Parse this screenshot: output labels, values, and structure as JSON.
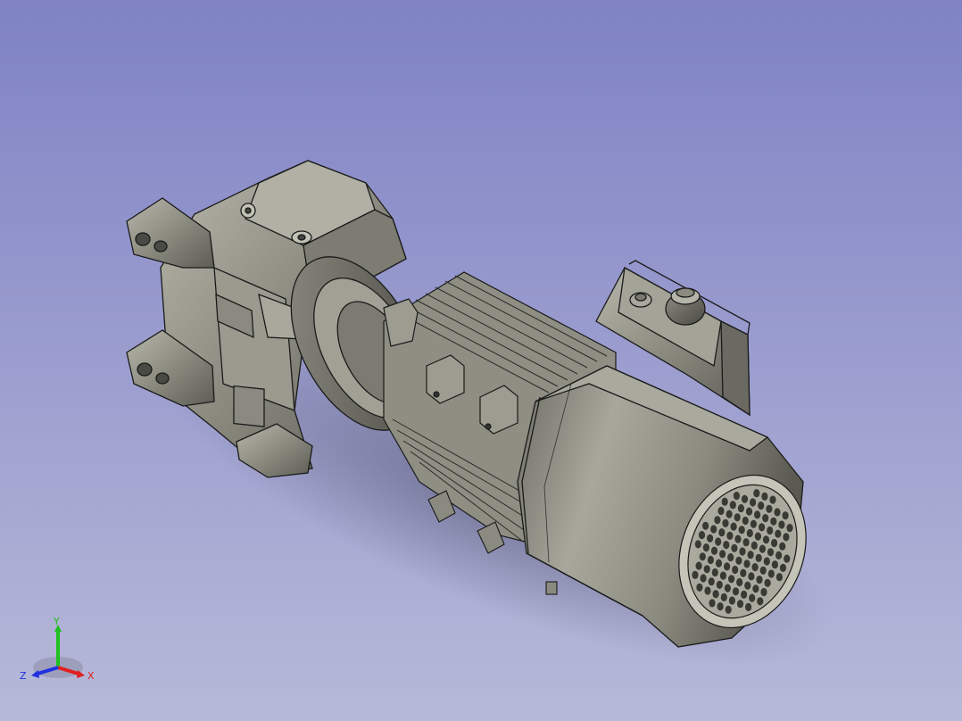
{
  "viewport": {
    "background_top": "#7f82c4",
    "background_bottom": "#b7b9d9"
  },
  "model": {
    "part_color": "#8e8e82",
    "edge_color": "#1a1a1a"
  },
  "axis_triad": {
    "x_label": "X",
    "y_label": "Y",
    "z_label": "Z",
    "x_color": "#e02020",
    "y_color": "#20c020",
    "z_color": "#2030e0"
  }
}
